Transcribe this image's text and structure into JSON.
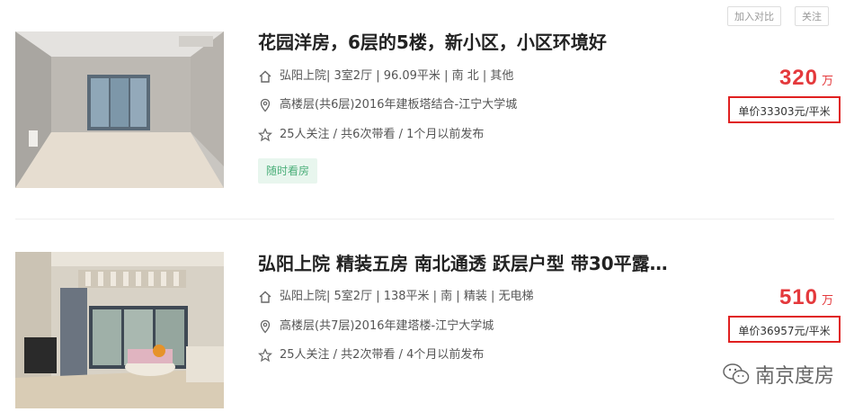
{
  "toolbar": {
    "compare_label": "加入对比",
    "follow_label": "关注"
  },
  "listings": [
    {
      "title": "花园洋房，6层的5楼，新小区，小区环境好",
      "house": {
        "community": "弘阳上院",
        "details": " | 3室2厅 | 96.09平米 | 南 北 | 其他"
      },
      "position": {
        "floor": "高楼层(共6层)2016年建板塔结合",
        "sep": " - ",
        "area": "江宁大学城"
      },
      "follow": "25人关注 / 共6次带看 / 1个月以前发布",
      "tag": "随时看房",
      "price": {
        "total": "320",
        "unit": "万",
        "unit_price": "单价33303元/平米"
      }
    },
    {
      "title": "弘阳上院 精装五房 南北通透 跃层户型 带30平露…",
      "house": {
        "community": "弘阳上院",
        "details": " | 5室2厅 | 138平米 | 南 | 精装 | 无电梯"
      },
      "position": {
        "floor": "高楼层(共7层)2016年建塔楼",
        "sep": " - ",
        "area": "江宁大学城"
      },
      "follow": "25人关注 / 共2次带看 / 4个月以前发布",
      "price": {
        "total": "510",
        "unit": "万",
        "unit_price": "单价36957元/平米"
      }
    }
  ],
  "watermark": {
    "text": "南京度房"
  },
  "colors": {
    "price": "#e4393c",
    "tag_text": "#4caf7a",
    "tag_bg": "#e8f6ee",
    "highlight_box": "#e02020"
  }
}
